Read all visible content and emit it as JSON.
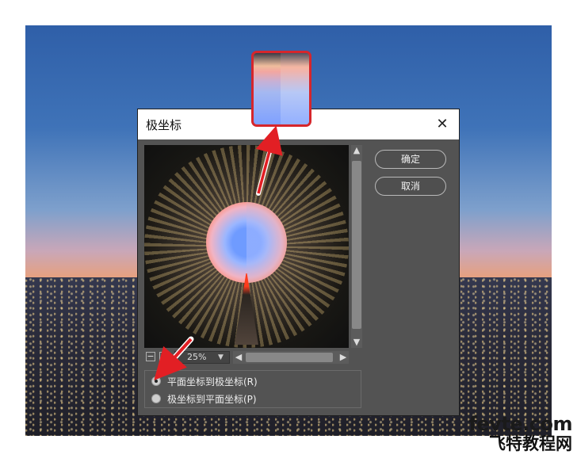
{
  "dialog": {
    "title": "极坐标",
    "close_glyph": "✕",
    "buttons": {
      "ok": "确定",
      "cancel": "取消"
    },
    "zoom": {
      "value": "25%",
      "minus_glyph": "−",
      "plus_glyph": "+"
    },
    "options": [
      {
        "label": "平面坐标到极坐标(R)",
        "selected": true
      },
      {
        "label": "极坐标到平面坐标(P)",
        "selected": false
      }
    ]
  },
  "watermark": {
    "line1": "fevte.com",
    "line2": "飞特教程网"
  },
  "colors": {
    "dialog_bg": "#535353",
    "accent_red": "#d6262c",
    "titlebar_bg": "#ffffff"
  },
  "icons": {
    "close": "close-icon",
    "zoom_out": "zoom-out-icon",
    "zoom_in": "zoom-in-icon",
    "dropdown": "chevron-down-icon"
  }
}
